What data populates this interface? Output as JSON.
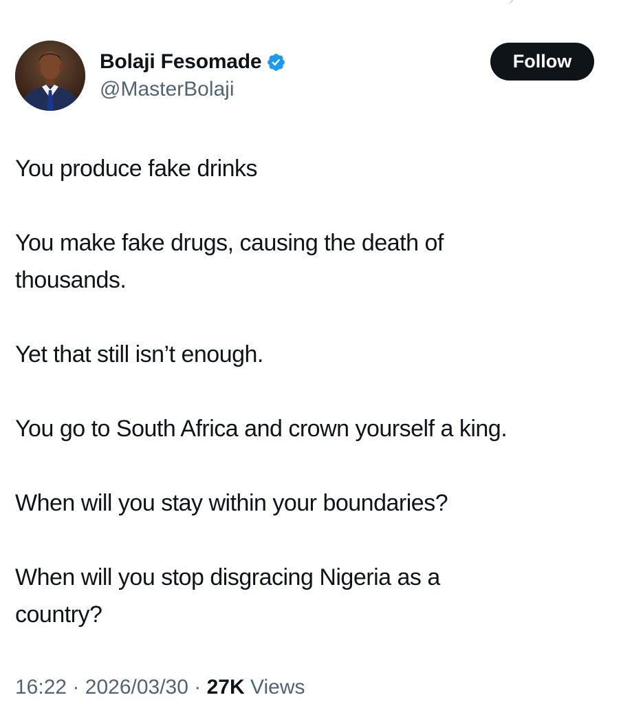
{
  "author": {
    "display_name": "Bolaji Fesomade",
    "handle": "@MasterBolaji",
    "verified": true
  },
  "follow_label": "Follow",
  "tweet": {
    "paragraphs": [
      "You produce fake drinks",
      "You make fake drugs, causing the death of\nthousands.",
      "Yet that still isn’t enough.",
      "You go to South Africa and crown yourself a king.",
      "When will you stay within your boundaries?",
      "When will you stop disgracing Nigeria as a\ncountry?"
    ]
  },
  "meta": {
    "time": "16:22",
    "separator": "·",
    "date": "2026/03/30",
    "views_count": "27K",
    "views_label": "Views"
  },
  "icons": {
    "verified": "verified-badge-icon"
  },
  "colors": {
    "text": "#0f1419",
    "secondary_text": "#536471",
    "follow_button": "#0f1419",
    "verified_badge": "#1d9bf0"
  }
}
